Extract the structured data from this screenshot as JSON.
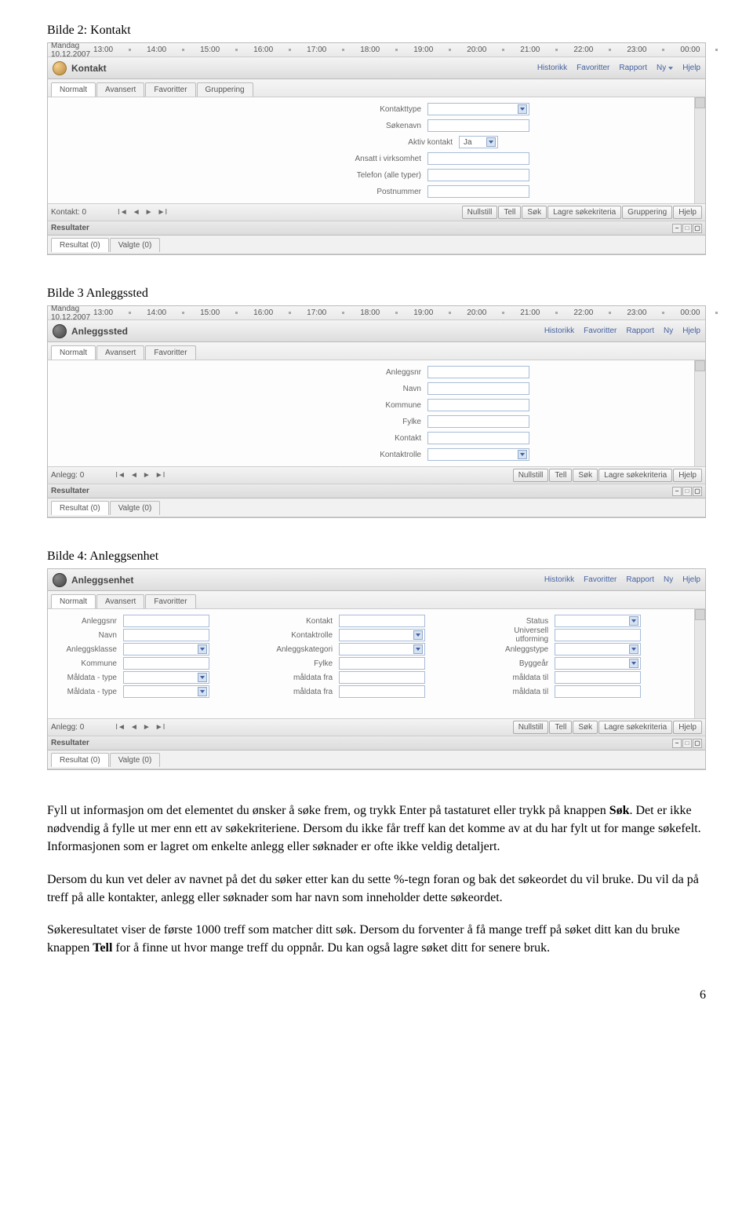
{
  "headings": {
    "b2": "Bilde 2: Kontakt",
    "b3": "Bilde 3 Anleggssted",
    "b4": "Bilde 4: Anleggsenhet"
  },
  "timeline": {
    "date": "Mandag 10.12.2007",
    "hours": [
      "13:00",
      "14:00",
      "15:00",
      "16:00",
      "17:00",
      "18:00",
      "19:00",
      "20:00",
      "21:00",
      "22:00",
      "23:00",
      "00:00"
    ]
  },
  "toplinks": {
    "historikk": "Historikk",
    "favoritter": "Favoritter",
    "rapport": "Rapport",
    "ny": "Ny",
    "hjelp": "Hjelp"
  },
  "kontakt": {
    "title": "Kontakt",
    "tabs": [
      "Normalt",
      "Avansert",
      "Favoritter",
      "Gruppering"
    ],
    "fields": {
      "kontakttype": "Kontakttype",
      "sokenavn": "Søkenavn",
      "aktiv": "Aktiv kontakt",
      "aktiv_val": "Ja",
      "ansatt": "Ansatt i virksomhet",
      "telefon": "Telefon (alle typer)",
      "postnr": "Postnummer"
    },
    "status": "Kontakt: 0",
    "btns": [
      "Nullstill",
      "Tell",
      "Søk",
      "Lagre søkekriteria",
      "Gruppering",
      "Hjelp"
    ]
  },
  "anleggssted": {
    "title": "Anleggssted",
    "tabs": [
      "Normalt",
      "Avansert",
      "Favoritter"
    ],
    "fields": {
      "anleggsnr": "Anleggsnr",
      "navn": "Navn",
      "kommune": "Kommune",
      "fylke": "Fylke",
      "kontakt": "Kontakt",
      "kontaktrolle": "Kontaktrolle"
    },
    "status": "Anlegg: 0",
    "btns": [
      "Nullstill",
      "Tell",
      "Søk",
      "Lagre søkekriteria",
      "Hjelp"
    ]
  },
  "anleggsenhet": {
    "title": "Anleggsenhet",
    "tabs": [
      "Normalt",
      "Avansert",
      "Favoritter"
    ],
    "col1": {
      "anleggsnr": "Anleggsnr",
      "navn": "Navn",
      "anleggsklasse": "Anleggsklasse",
      "kommune": "Kommune",
      "maldata_type1": "Måldata - type",
      "maldata_type2": "Måldata - type"
    },
    "col2": {
      "kontakt": "Kontakt",
      "kontaktrolle": "Kontaktrolle",
      "anleggskategori": "Anleggskategori",
      "fylke": "Fylke",
      "maldata_fra1": "måldata fra",
      "maldata_fra2": "måldata fra"
    },
    "col3": {
      "status": "Status",
      "universell": "Universell utforming",
      "anleggstype": "Anleggstype",
      "byggear": "Byggeår",
      "maldata_til1": "måldata til",
      "maldata_til2": "måldata til"
    },
    "status": "Anlegg: 0",
    "btns": [
      "Nullstill",
      "Tell",
      "Søk",
      "Lagre søkekriteria",
      "Hjelp"
    ]
  },
  "results": {
    "header": "Resultater",
    "tab1": "Resultat (0)",
    "tab2": "Valgte (0)"
  },
  "nav_glyphs": {
    "first": "I◄",
    "prev": "◄",
    "next": "►",
    "last": "►I"
  },
  "prose": {
    "p1a": "Fyll ut informasjon om det elementet du ønsker å søke frem, og trykk Enter på tastaturet eller trykk på knappen ",
    "p1b": "Søk",
    "p1c": ". Det er ikke nødvendig å fylle ut mer enn ett av søkekriteriene. Dersom du ikke får treff kan det komme av at du har fylt ut for mange søkefelt. Informasjonen som er lagret om enkelte anlegg eller søknader er ofte ikke veldig detaljert.",
    "p2": "Dersom du kun vet deler av navnet på det du søker etter kan du sette %-tegn foran og bak det søkeordet du vil bruke. Du vil da på treff på alle kontakter, anlegg eller søknader som har navn som inneholder dette søkeordet.",
    "p3a": "Søkeresultatet viser de første 1000 treff som matcher ditt søk. Dersom du forventer å få mange treff på søket ditt kan du bruke knappen ",
    "p3b": "Tell",
    "p3c": " for å finne ut hvor mange treff du oppnår. Du kan også lagre søket ditt for senere bruk."
  },
  "pagenum": "6"
}
